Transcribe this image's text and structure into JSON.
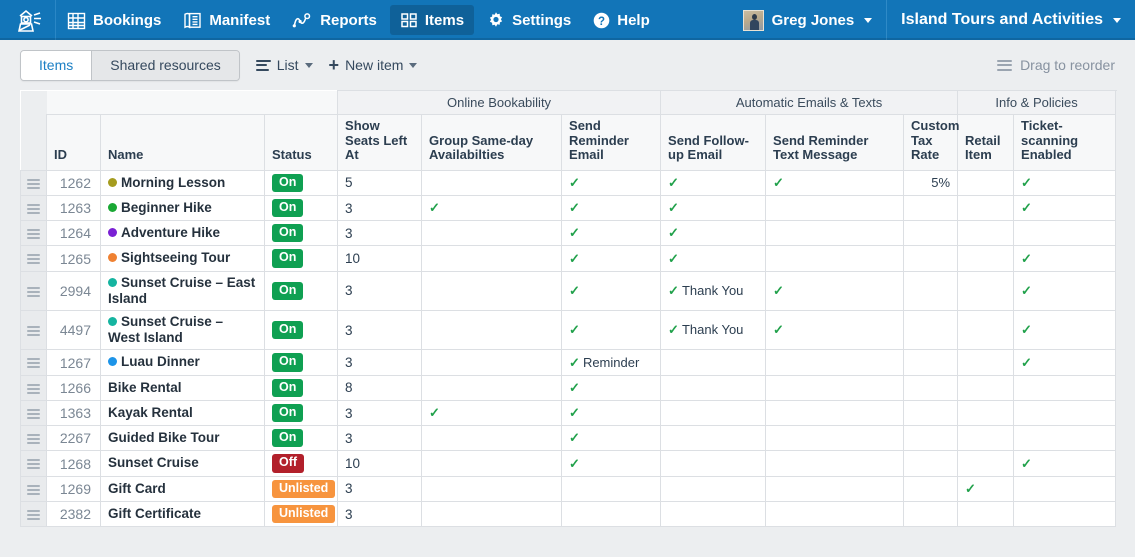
{
  "topnav": {
    "logo_name": "lighthouse-logo",
    "items": [
      {
        "label": "Bookings",
        "icon": "calendar-icon",
        "active": false
      },
      {
        "label": "Manifest",
        "icon": "manifest-icon",
        "active": false
      },
      {
        "label": "Reports",
        "icon": "reports-chart-icon",
        "active": false
      },
      {
        "label": "Items",
        "icon": "items-grid-icon",
        "active": true
      },
      {
        "label": "Settings",
        "icon": "gear-icon",
        "active": false
      },
      {
        "label": "Help",
        "icon": "help-circle-icon",
        "active": false
      }
    ],
    "user": "Greg Jones",
    "org": "Island Tours and Activities",
    "bg_color": "#1275b8",
    "active_color": "#0f6199"
  },
  "toolbar": {
    "tabs": [
      {
        "label": "Items",
        "active": true
      },
      {
        "label": "Shared resources",
        "active": false
      }
    ],
    "view_label": "List",
    "new_item_label": "New item",
    "drag_to_reorder": "Drag to reorder"
  },
  "table": {
    "groups": [
      {
        "label": "",
        "span": 3,
        "blank": true
      },
      {
        "label": "Online Bookability",
        "span": 3
      },
      {
        "label": "Automatic Emails & Texts",
        "span": 3
      },
      {
        "label": "Info & Policies",
        "span": 3
      }
    ],
    "columns": [
      "ID",
      "Name",
      "Status",
      "Show Seats Left At",
      "Group Same-day Availabilties",
      "Send Reminder Email",
      "Send Follow-up Email",
      "Send Reminder Text Message",
      "Custom Tax Rate",
      "Retail Item",
      "Ticket-scanning Enabled"
    ],
    "status_colors": {
      "On": "#0fa052",
      "Off": "#b2202b",
      "Unlisted": "#f7943e"
    },
    "rows": [
      {
        "id": "1262",
        "name": "Morning Lesson",
        "dot": "#a59c1f",
        "status": "On",
        "seats_left": "5",
        "group_sameday": "",
        "reminder_email": "✓",
        "followup_email": "✓",
        "reminder_text": "✓",
        "tax_rate": "5%",
        "retail_item": "",
        "ticket_scanning": "✓"
      },
      {
        "id": "1263",
        "name": "Beginner Hike",
        "dot": "#1aa834",
        "status": "On",
        "seats_left": "3",
        "group_sameday": "✓",
        "reminder_email": "✓",
        "followup_email": "✓",
        "reminder_text": "",
        "tax_rate": "",
        "retail_item": "",
        "ticket_scanning": "✓"
      },
      {
        "id": "1264",
        "name": "Adventure Hike",
        "dot": "#7a20d4",
        "status": "On",
        "seats_left": "3",
        "group_sameday": "",
        "reminder_email": "✓",
        "followup_email": "✓",
        "reminder_text": "",
        "tax_rate": "",
        "retail_item": "",
        "ticket_scanning": ""
      },
      {
        "id": "1265",
        "name": "Sightseeing Tour",
        "dot": "#ef8132",
        "status": "On",
        "seats_left": "10",
        "group_sameday": "",
        "reminder_email": "✓",
        "followup_email": "✓",
        "reminder_text": "",
        "tax_rate": "",
        "retail_item": "",
        "ticket_scanning": "✓"
      },
      {
        "id": "2994",
        "name": "Sunset Cruise – East Island",
        "dot": "#15b4a0",
        "status": "On",
        "seats_left": "3",
        "group_sameday": "",
        "reminder_email": "✓",
        "followup_email": "✓",
        "followup_label": "Thank You",
        "reminder_text": "✓",
        "tax_rate": "",
        "retail_item": "",
        "ticket_scanning": "✓"
      },
      {
        "id": "4497",
        "name": "Sunset Cruise – West Island",
        "dot": "#15b4a0",
        "status": "On",
        "seats_left": "3",
        "group_sameday": "",
        "reminder_email": "✓",
        "followup_email": "✓",
        "followup_label": "Thank You",
        "reminder_text": "✓",
        "tax_rate": "",
        "retail_item": "",
        "ticket_scanning": "✓"
      },
      {
        "id": "1267",
        "name": "Luau Dinner",
        "dot": "#1d94e8",
        "status": "On",
        "seats_left": "3",
        "group_sameday": "",
        "reminder_email": "✓",
        "reminder_label": "Reminder",
        "followup_email": "",
        "reminder_text": "",
        "tax_rate": "",
        "retail_item": "",
        "ticket_scanning": "✓"
      },
      {
        "id": "1266",
        "name": "Bike Rental",
        "dot": "",
        "status": "On",
        "seats_left": "8",
        "group_sameday": "",
        "reminder_email": "✓",
        "followup_email": "",
        "reminder_text": "",
        "tax_rate": "",
        "retail_item": "",
        "ticket_scanning": ""
      },
      {
        "id": "1363",
        "name": "Kayak Rental",
        "dot": "",
        "status": "On",
        "seats_left": "3",
        "group_sameday": "✓",
        "reminder_email": "✓",
        "followup_email": "",
        "reminder_text": "",
        "tax_rate": "",
        "retail_item": "",
        "ticket_scanning": ""
      },
      {
        "id": "2267",
        "name": "Guided Bike Tour",
        "dot": "",
        "status": "On",
        "seats_left": "3",
        "group_sameday": "",
        "reminder_email": "✓",
        "followup_email": "",
        "reminder_text": "",
        "tax_rate": "",
        "retail_item": "",
        "ticket_scanning": ""
      },
      {
        "id": "1268",
        "name": "Sunset Cruise",
        "dot": "",
        "status": "Off",
        "seats_left": "10",
        "group_sameday": "",
        "reminder_email": "✓",
        "followup_email": "",
        "reminder_text": "",
        "tax_rate": "",
        "retail_item": "",
        "ticket_scanning": "✓"
      },
      {
        "id": "1269",
        "name": "Gift Card",
        "dot": "",
        "status": "Unlisted",
        "seats_left": "3",
        "group_sameday": "",
        "reminder_email": "",
        "followup_email": "",
        "reminder_text": "",
        "tax_rate": "",
        "retail_item": "✓",
        "ticket_scanning": ""
      },
      {
        "id": "2382",
        "name": "Gift Certificate",
        "dot": "",
        "status": "Unlisted",
        "seats_left": "3",
        "group_sameday": "",
        "reminder_email": "",
        "followup_email": "",
        "reminder_text": "",
        "tax_rate": "",
        "retail_item": "",
        "ticket_scanning": ""
      }
    ]
  }
}
